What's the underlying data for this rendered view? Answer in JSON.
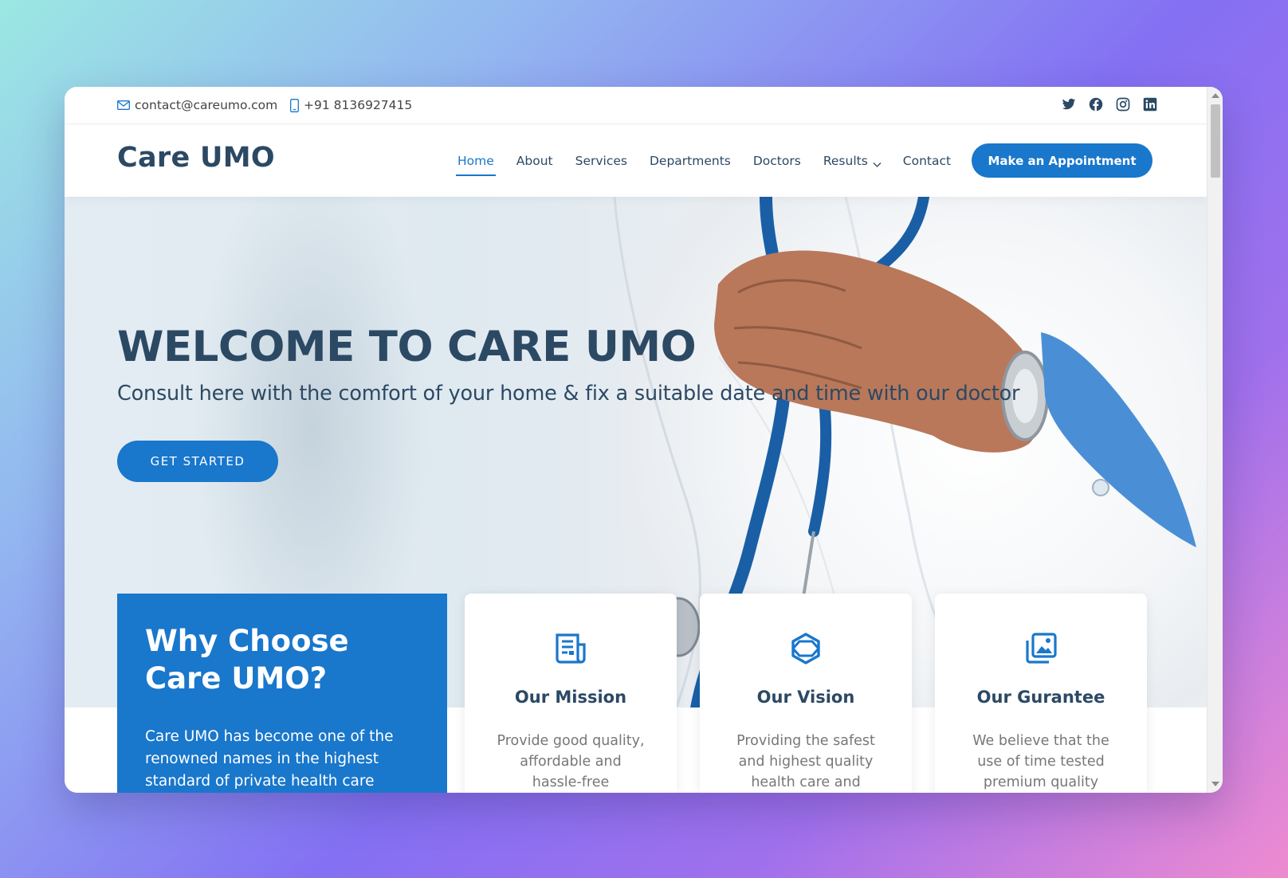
{
  "topbar": {
    "email": "contact@careumo.com",
    "phone": "+91 8136927415",
    "socials": [
      "twitter-icon",
      "facebook-icon",
      "instagram-icon",
      "linkedin-icon"
    ]
  },
  "header": {
    "logo": "Care UMO",
    "nav": [
      {
        "label": "Home",
        "active": true
      },
      {
        "label": "About"
      },
      {
        "label": "Services"
      },
      {
        "label": "Departments"
      },
      {
        "label": "Doctors"
      },
      {
        "label": "Results",
        "dropdown": true
      },
      {
        "label": "Contact"
      }
    ],
    "cta": "Make an Appointment"
  },
  "hero": {
    "title": "WELCOME TO CARE UMO",
    "subtitle": "Consult here with the comfort of your home & fix a suitable date and time with our doctor",
    "button": "GET STARTED"
  },
  "why": {
    "title": "Why Choose Care UMO?",
    "text": "Care UMO has become one of the renowned names in the highest standard of private health care sector."
  },
  "cards": [
    {
      "icon": "newspaper-icon",
      "title": "Our Mission",
      "text": "Provide good quality, affordable and hassle-free healthcare to"
    },
    {
      "icon": "cube-icon",
      "title": "Our Vision",
      "text": "Providing the safest and highest quality health care and"
    },
    {
      "icon": "images-icon",
      "title": "Our Gurantee",
      "text": "We believe that the use of time tested premium quality products"
    }
  ],
  "colors": {
    "accent": "#1977cc",
    "heading": "#2c4964"
  }
}
